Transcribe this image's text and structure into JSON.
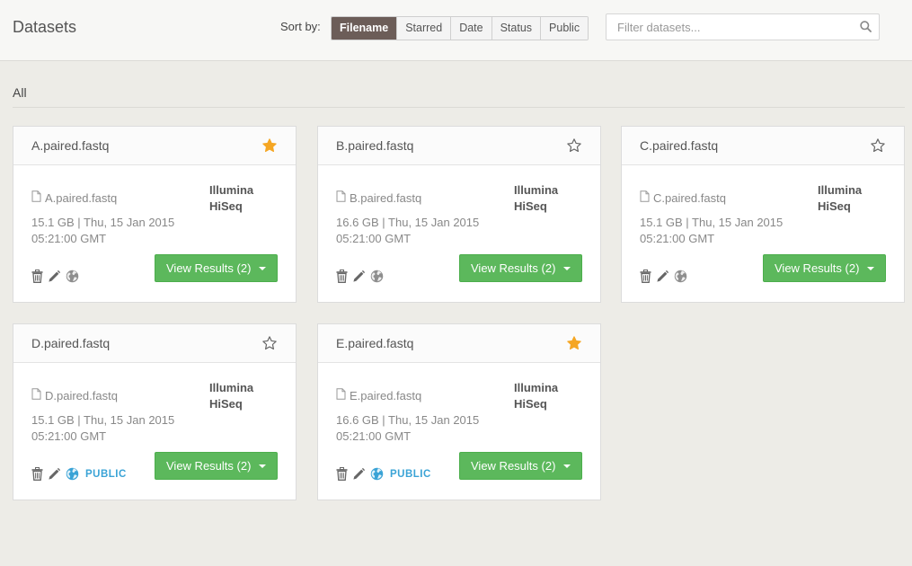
{
  "header": {
    "title": "Datasets",
    "sort_label": "Sort by:",
    "sort_options": [
      "Filename",
      "Starred",
      "Date",
      "Status",
      "Public"
    ],
    "sort_active": "Filename",
    "search": {
      "placeholder": "Filter datasets...",
      "value": ""
    }
  },
  "section": {
    "label": "All"
  },
  "colors": {
    "accent": "#6c5d58",
    "success": "#5cb85c",
    "star": "#f5a623",
    "public": "#3aa3d6"
  },
  "datasets": [
    {
      "title": "A.paired.fastq",
      "file": "A.paired.fastq",
      "platform": "Illumina HiSeq",
      "size_date": "15.1 GB | Thu, 15 Jan 2015 05:21:00 GMT",
      "starred": true,
      "public": false,
      "public_label": "",
      "results_label": "View Results (2)"
    },
    {
      "title": "B.paired.fastq",
      "file": "B.paired.fastq",
      "platform": "Illumina HiSeq",
      "size_date": "16.6 GB | Thu, 15 Jan 2015 05:21:00 GMT",
      "starred": false,
      "public": false,
      "public_label": "",
      "results_label": "View Results (2)"
    },
    {
      "title": "C.paired.fastq",
      "file": "C.paired.fastq",
      "platform": "Illumina HiSeq",
      "size_date": "15.1 GB | Thu, 15 Jan 2015 05:21:00 GMT",
      "starred": false,
      "public": false,
      "public_label": "",
      "results_label": "View Results (2)"
    },
    {
      "title": "D.paired.fastq",
      "file": "D.paired.fastq",
      "platform": "Illumina HiSeq",
      "size_date": "15.1 GB | Thu, 15 Jan 2015 05:21:00 GMT",
      "starred": false,
      "public": true,
      "public_label": "PUBLIC",
      "results_label": "View Results (2)"
    },
    {
      "title": "E.paired.fastq",
      "file": "E.paired.fastq",
      "platform": "Illumina HiSeq",
      "size_date": "16.6 GB | Thu, 15 Jan 2015 05:21:00 GMT",
      "starred": true,
      "public": true,
      "public_label": "PUBLIC",
      "results_label": "View Results (2)"
    }
  ]
}
